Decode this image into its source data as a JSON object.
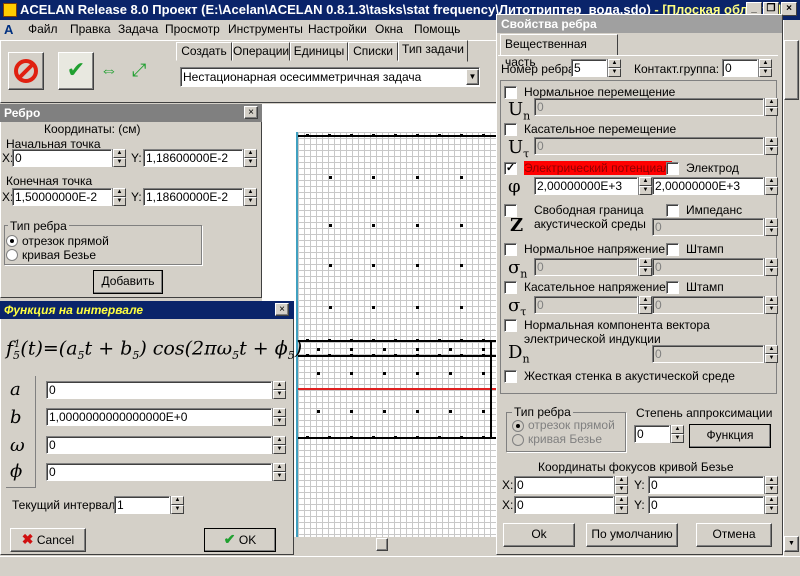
{
  "app": {
    "title": "ACELAN Release 8.0 Проект (E:\\Acelan\\ACELAN 0.8.1.3\\tasks\\stat frequency\\Литотриптер_вода.sdo)",
    "title_suffix": "- [Плоская область]"
  },
  "menu": [
    "Файл",
    "Правка",
    "Задача",
    "Просмотр",
    "Инструменты",
    "Настройки",
    "Окна",
    "Помощь"
  ],
  "tabs": [
    "Создать",
    "Операции",
    "Единицы",
    "Списки",
    "Тип задачи"
  ],
  "task_type": "Нестационарная осесимметричная задача",
  "edge_panel": {
    "title": "Ребро",
    "coords_label": "Координаты: (см)",
    "start_label": "Начальная точка",
    "start_x": "0",
    "start_y": "1,18600000E-2",
    "end_label": "Конечная точка",
    "end_x": "1,50000000E-2",
    "end_y": "1,18600000E-2",
    "x_label": "X:",
    "y_label": "Y:",
    "type_label": "Тип ребра",
    "type_line": "отрезок прямой",
    "type_bezier": "кривая Безье",
    "add_button": "Добавить"
  },
  "func_panel": {
    "title": "Функция на интервале",
    "rows": [
      {
        "sym": "a",
        "value": "0"
      },
      {
        "sym": "b",
        "value": "1,0000000000000000E+0"
      },
      {
        "sym": "ω",
        "value": "0"
      },
      {
        "sym": "ϕ",
        "value": "0"
      }
    ],
    "interval_label": "Текущий интервал:",
    "interval_value": "1",
    "cancel": "Cancel",
    "ok": "OK"
  },
  "props": {
    "title": "Свойства ребра",
    "tab": "Вещественная часть",
    "edge_num_label": "Номер ребра:",
    "edge_num": "5",
    "contact_label": "Контакт.группа:",
    "contact": "0",
    "normal_disp": "Нормальное перемещение",
    "tang_disp": "Касательное перемещение",
    "el_potential": "Электрический потенциал",
    "electrode": "Электрод",
    "phi_val1": "2,00000000E+3",
    "phi_val2": "2,00000000E+3",
    "free_boundary": "Свободная граница\nакустической  среды",
    "impedance": "Импеданс",
    "normal_stress": "Нормальное напряжение",
    "stamp": "Штамп",
    "tang_stress": "Касательное напряжение",
    "stamp2": "Штамп",
    "normal_induction": "Нормальная компонента вектора\nэлектрической индукции",
    "rigid_wall": "Жесткая стенка в акустической среде",
    "zero": "0",
    "edge_type_label": "Тип ребра",
    "edge_type_line": "отрезок прямой",
    "edge_type_bezier": "кривая Безье",
    "approx_label": "Степень аппроксимации",
    "approx_value": "0",
    "func_button": "Функция",
    "bezier_coords": "Координаты фокусов кривой Безье",
    "x_label": "X:",
    "y_label": "Y:",
    "bx1": "0",
    "by1": "0",
    "bx2": "0",
    "by2": "0",
    "ok": "Ok",
    "default": "По умолчанию",
    "cancel": "Отмена"
  }
}
